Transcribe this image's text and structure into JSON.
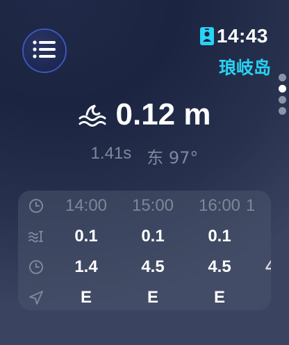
{
  "status": {
    "time": "14:43",
    "location": "琅岐岛",
    "accent": "#28d3f5"
  },
  "icons": {
    "menu": "list-icon",
    "badge": "id-badge-icon",
    "wave": "wave-icon",
    "time_row": "clock-icon",
    "height_row": "wave-height-icon",
    "period_row": "clock-icon",
    "direction_row": "navigation-arrow-icon"
  },
  "current": {
    "height": "0.12 m",
    "period": "1.41s",
    "direction": "东 97°"
  },
  "forecast": {
    "times": [
      "14:00",
      "15:00",
      "16:00",
      "1"
    ],
    "heights": [
      "0.1",
      "0.1",
      "0.1",
      ""
    ],
    "periods": [
      "1.4",
      "4.5",
      "4.5",
      "4"
    ],
    "directions": [
      "E",
      "E",
      "E",
      ""
    ]
  }
}
